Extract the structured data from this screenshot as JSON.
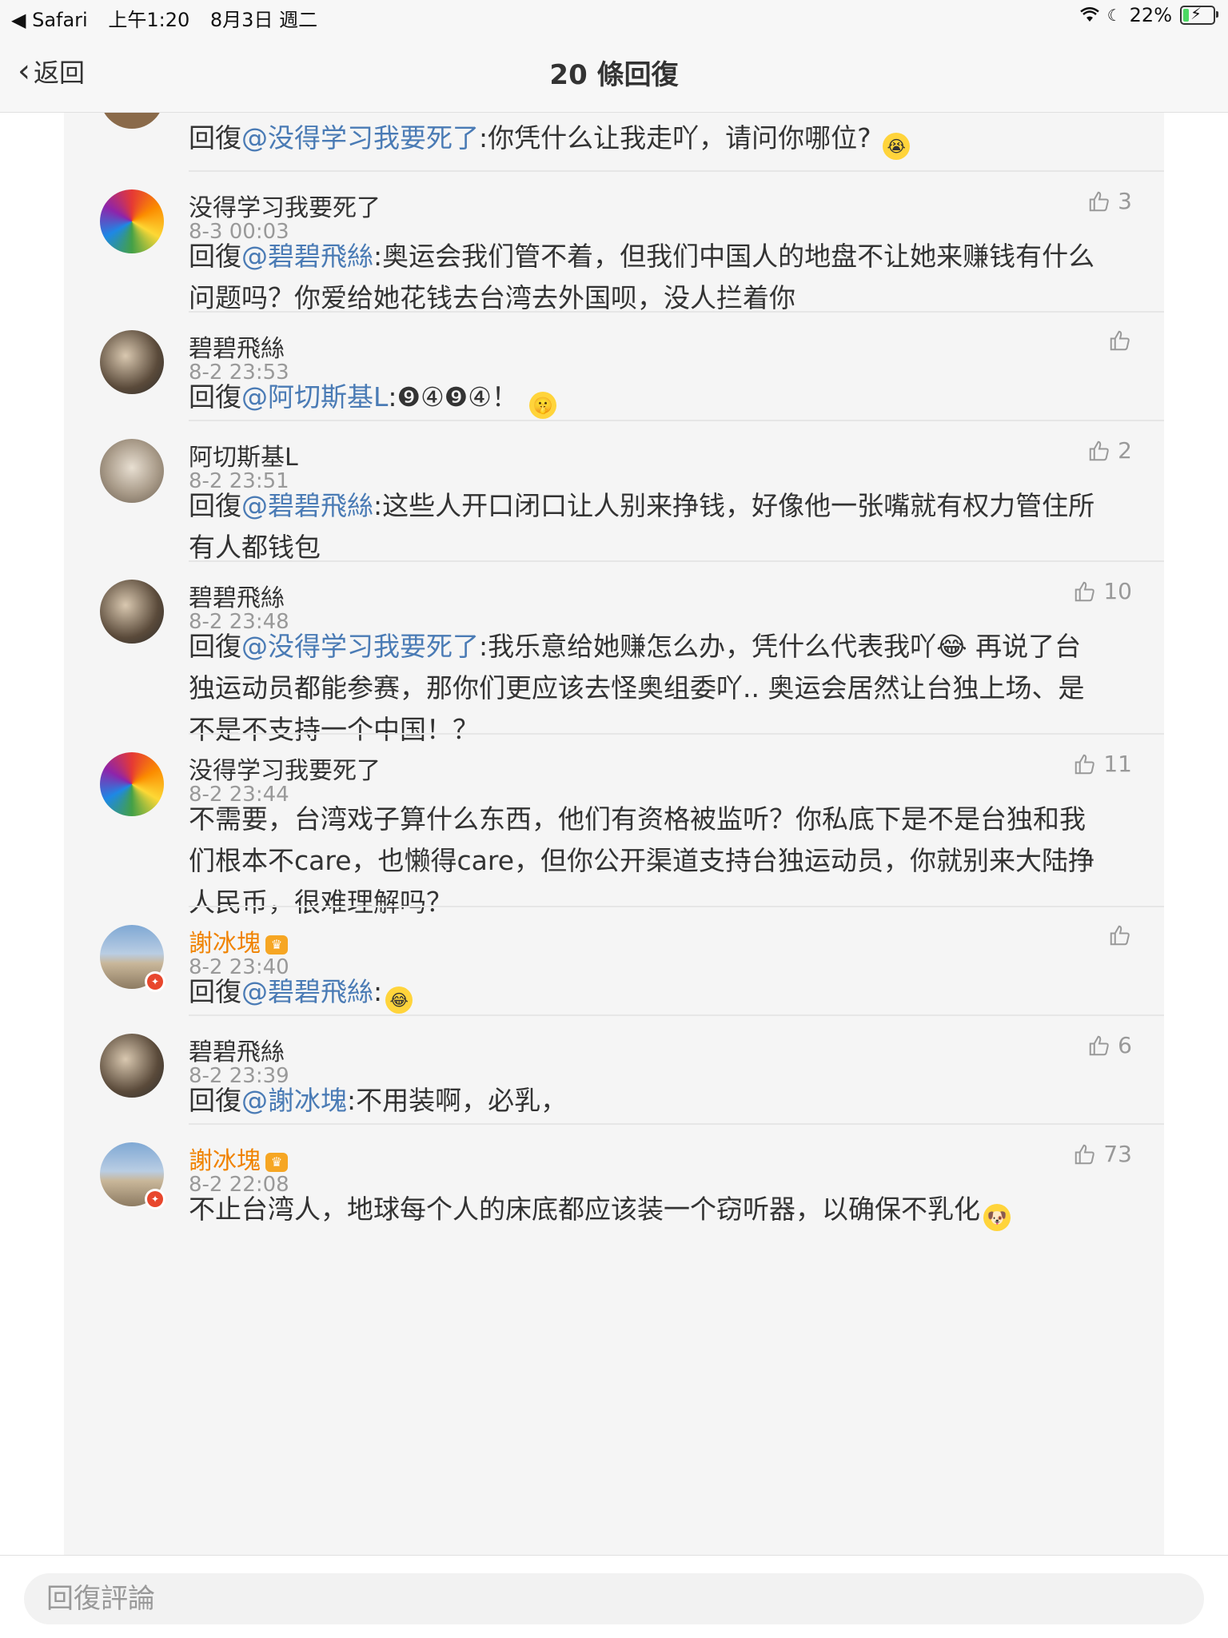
{
  "status_bar": {
    "app": "◀ Safari",
    "time": "上午1:20",
    "date": "8月3日 週二",
    "battery": "22%",
    "battery_level": 0.22
  },
  "nav": {
    "back_label": "返回",
    "title": "20 條回復"
  },
  "comments": [
    {
      "name": "",
      "time": "",
      "reply_prefix": "回復",
      "mention": "@没得学习我要死了",
      "text": ":你凭什么让我走吖，请问你哪位?",
      "emoji": "crying-emoji",
      "likes": ""
    },
    {
      "name": "没得学习我要死了",
      "time": "8-3 00:03",
      "reply_prefix": "回復",
      "mention": "@碧碧飛絲",
      "text": ":奥运会我们管不着，但我们中国人的地盘不让她来赚钱有什么问题吗？你爱给她花钱去台湾去外国呗，没人拦着你",
      "likes": "3"
    },
    {
      "name": "碧碧飛絲",
      "time": "8-2 23:53",
      "reply_prefix": "回復",
      "mention": "@阿切斯基L",
      "text": ":❾④❾④！",
      "emoji": "shush-emoji",
      "likes": ""
    },
    {
      "name": "阿切斯基L",
      "time": "8-2 23:51",
      "reply_prefix": "回復",
      "mention": "@碧碧飛絲",
      "text": ":这些人开口闭口让人别来挣钱，好像他一张嘴就有权力管住所有人都钱包",
      "likes": "2"
    },
    {
      "name": "碧碧飛絲",
      "time": "8-2 23:48",
      "reply_prefix": "回復",
      "mention": "@没得学习我要死了",
      "text": ":我乐意给她赚怎么办，凭什么代表我吖😂 再说了台独运动员都能参赛，那你们更应该去怪奥组委吖.. 奥运会居然让台独上场、是不是不支持一个中国！？",
      "likes": "10"
    },
    {
      "name": "没得学习我要死了",
      "time": "8-2 23:44",
      "reply_prefix": "",
      "mention": "",
      "text": "不需要，台湾戏子算什么东西，他们有资格被监听？你私底下是不是台独和我们根本不care，也懒得care，但你公开渠道支持台独运动员，你就别来大陆挣人民币，很难理解吗？",
      "likes": "11"
    },
    {
      "name": "謝冰塊",
      "time": "8-2 23:40",
      "reply_prefix": "回復",
      "mention": "@碧碧飛絲",
      "text": ":",
      "emoji": "laughing-emoji",
      "likes": ""
    },
    {
      "name": "碧碧飛絲",
      "time": "8-2 23:39",
      "reply_prefix": "回復",
      "mention": "@謝冰塊",
      "text": ":不用装啊，必乳，",
      "likes": "6"
    },
    {
      "name": "謝冰塊",
      "time": "8-2 22:08",
      "reply_prefix": "",
      "mention": "",
      "text": "不止台湾人，地球每个人的床底都应该装一个窃听器，以确保不乳化",
      "emoji": "doge-emoji",
      "likes": "73"
    }
  ],
  "reply_bar": {
    "placeholder": "回復評論"
  },
  "colors": {
    "mention": "#4a7bb5",
    "vip_name": "#f08300",
    "meta": "#999999"
  }
}
